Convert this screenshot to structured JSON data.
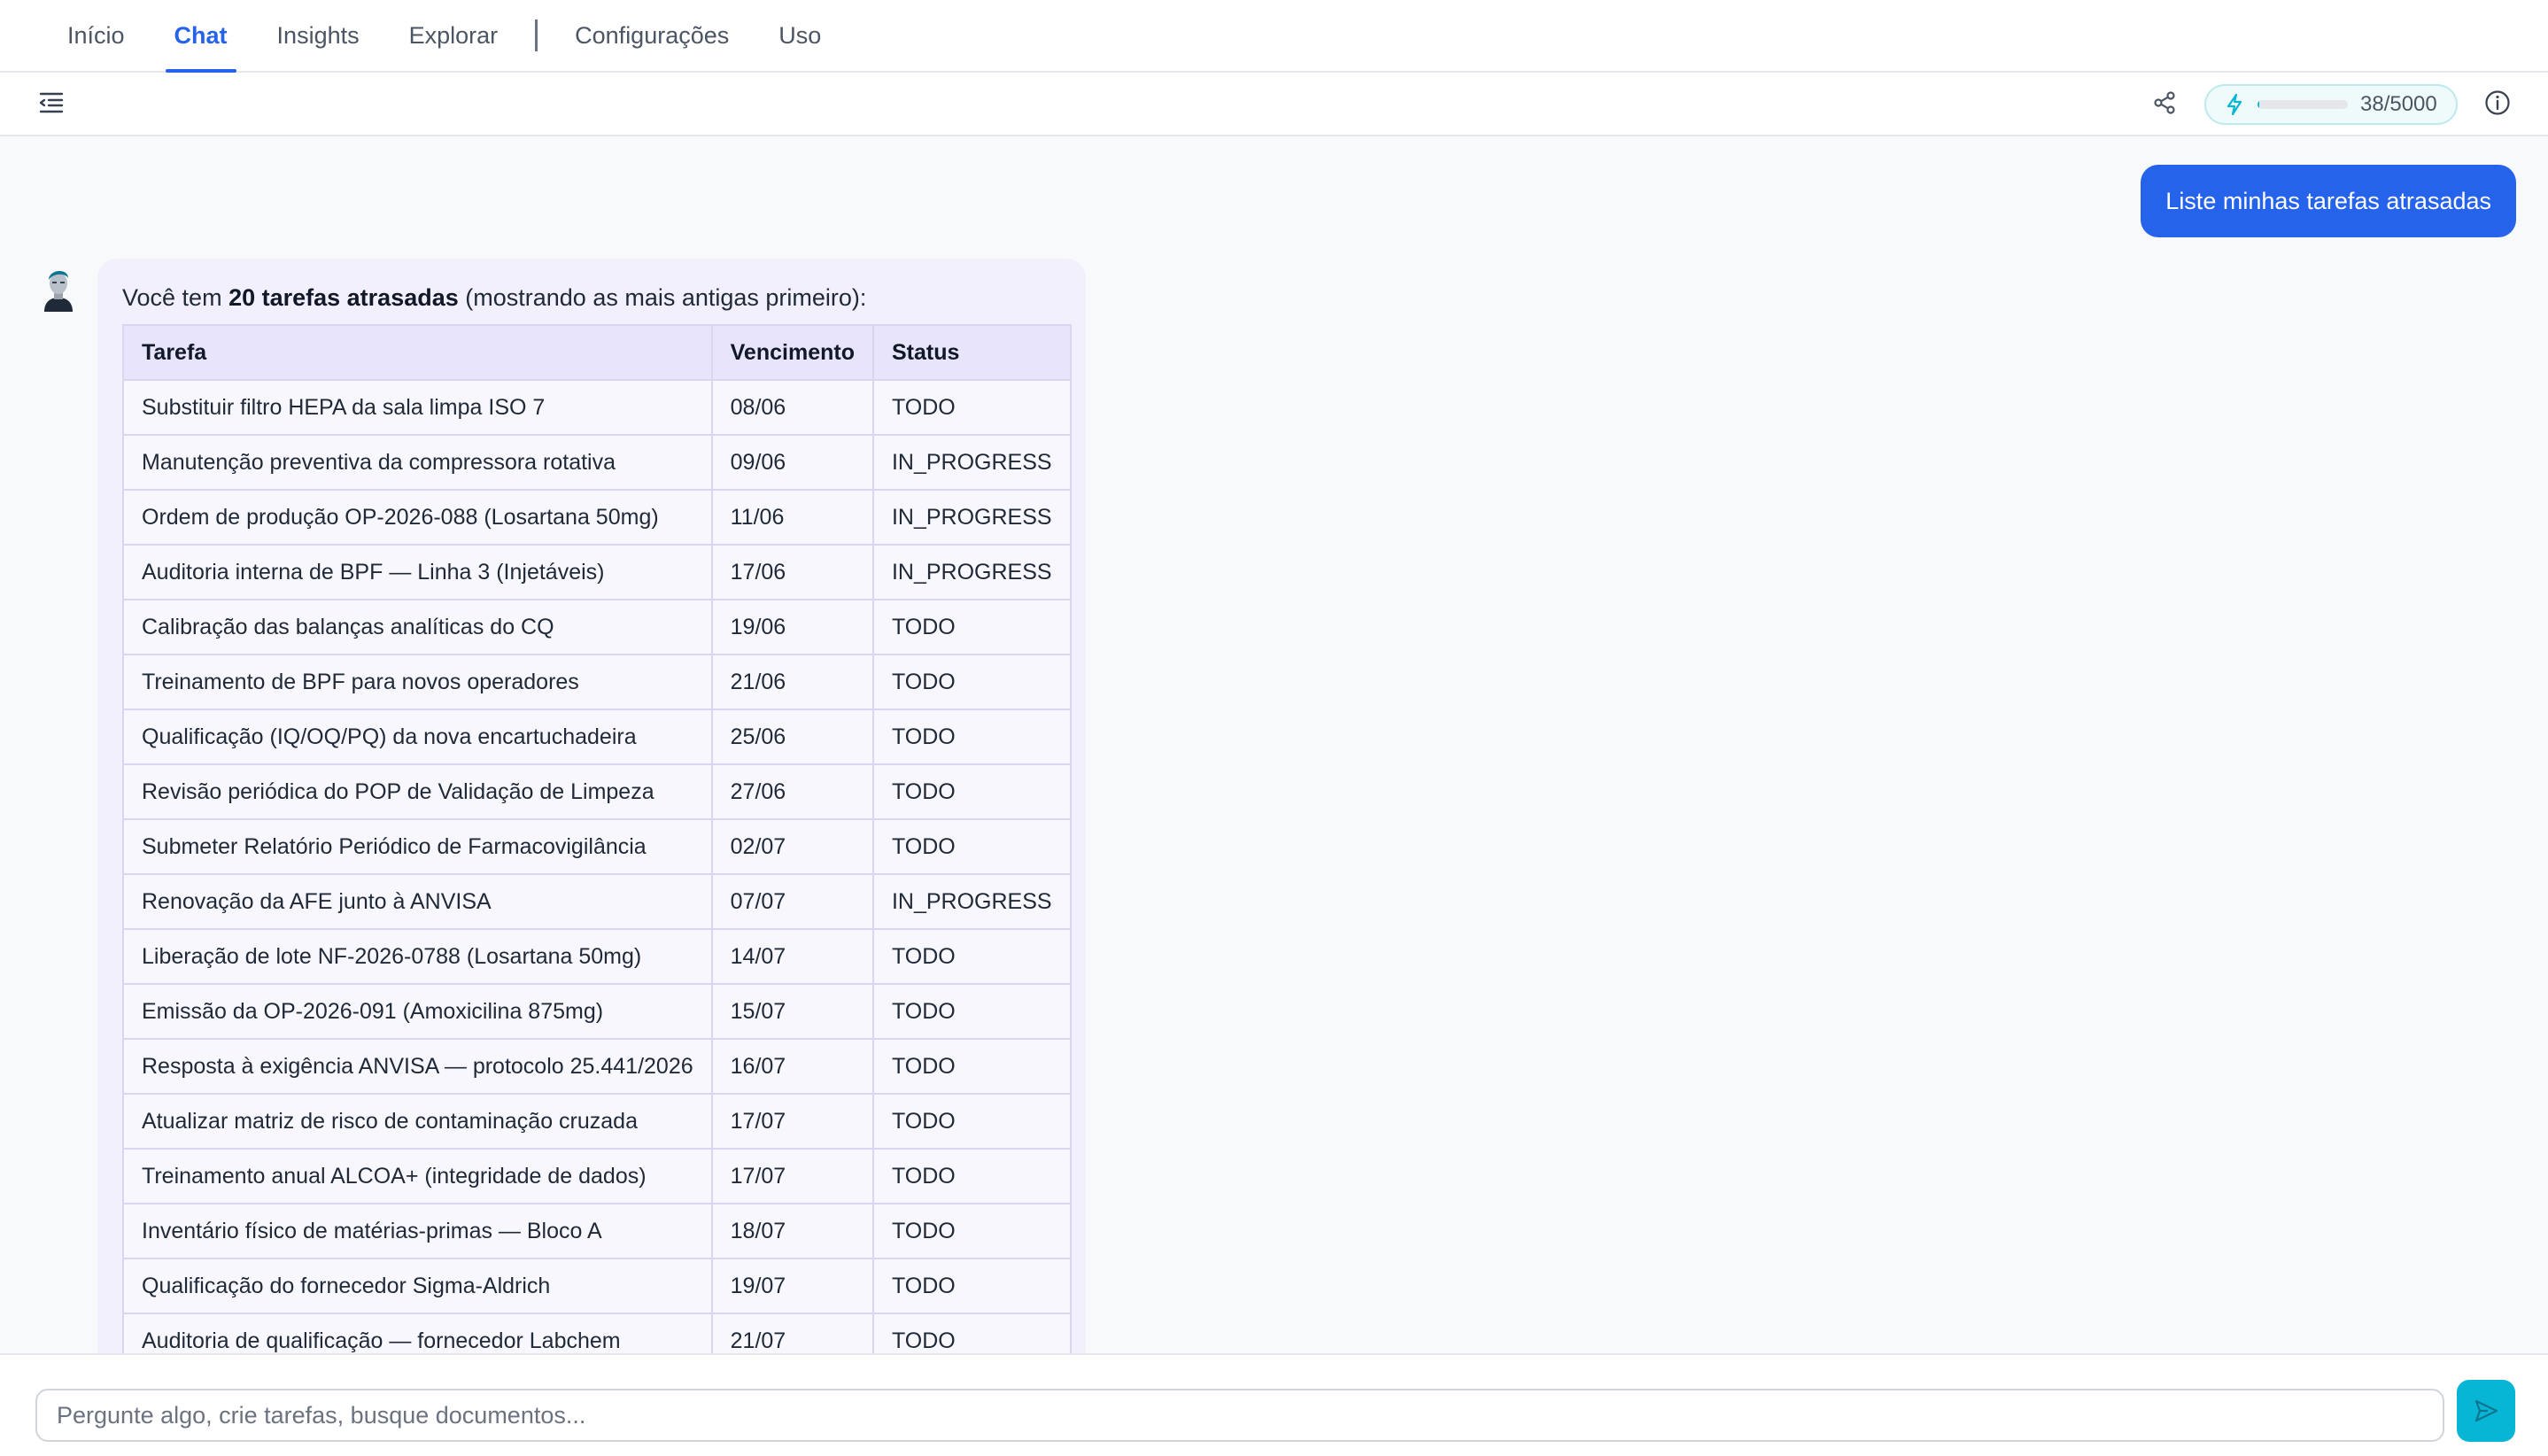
{
  "nav": {
    "tabs": [
      {
        "label": "Início"
      },
      {
        "label": "Chat"
      },
      {
        "label": "Insights"
      },
      {
        "label": "Explorar"
      },
      {
        "label": "Configurações"
      },
      {
        "label": "Uso"
      }
    ],
    "active_tab": "Chat"
  },
  "toolbar": {
    "icons": {
      "collapse": "sidebar-collapse-icon",
      "share": "share-icon",
      "quota": "lightning-icon",
      "info": "info-icon"
    },
    "quota": {
      "used": 38,
      "total": 5000,
      "label": "38/5000"
    }
  },
  "chat": {
    "user_message": "Liste minhas tarefas atrasadas",
    "assistant": {
      "intro_prefix": "Você tem ",
      "intro_bold": "20 tarefas atrasadas",
      "intro_suffix": " (mostrando as mais antigas primeiro):",
      "table": {
        "headers": [
          "Tarefa",
          "Vencimento",
          "Status"
        ],
        "rows": [
          [
            "Substituir filtro HEPA da sala limpa ISO 7",
            "08/06",
            "TODO"
          ],
          [
            "Manutenção preventiva da compressora rotativa",
            "09/06",
            "IN_PROGRESS"
          ],
          [
            "Ordem de produção OP-2026-088 (Losartana 50mg)",
            "11/06",
            "IN_PROGRESS"
          ],
          [
            "Auditoria interna de BPF — Linha 3 (Injetáveis)",
            "17/06",
            "IN_PROGRESS"
          ],
          [
            "Calibração das balanças analíticas do CQ",
            "19/06",
            "TODO"
          ],
          [
            "Treinamento de BPF para novos operadores",
            "21/06",
            "TODO"
          ],
          [
            "Qualificação (IQ/OQ/PQ) da nova encartuchadeira",
            "25/06",
            "TODO"
          ],
          [
            "Revisão periódica do POP de Validação de Limpeza",
            "27/06",
            "TODO"
          ],
          [
            "Submeter Relatório Periódico de Farmacovigilância",
            "02/07",
            "TODO"
          ],
          [
            "Renovação da AFE junto à ANVISA",
            "07/07",
            "IN_PROGRESS"
          ],
          [
            "Liberação de lote NF-2026-0788 (Losartana 50mg)",
            "14/07",
            "TODO"
          ],
          [
            "Emissão da OP-2026-091 (Amoxicilina 875mg)",
            "15/07",
            "TODO"
          ],
          [
            "Resposta à exigência ANVISA — protocolo 25.441/2026",
            "16/07",
            "TODO"
          ],
          [
            "Atualizar matriz de risco de contaminação cruzada",
            "17/07",
            "TODO"
          ],
          [
            "Treinamento anual ALCOA+ (integridade de dados)",
            "17/07",
            "TODO"
          ],
          [
            "Inventário físico de matérias-primas — Bloco A",
            "18/07",
            "TODO"
          ],
          [
            "Qualificação do fornecedor Sigma-Aldrich",
            "19/07",
            "TODO"
          ],
          [
            "Auditoria de qualificação — fornecedor Labchem",
            "21/07",
            "TODO"
          ]
        ]
      }
    }
  },
  "input": {
    "placeholder": "Pergunte algo, crie tarefas, busque documentos...",
    "value": ""
  },
  "colors": {
    "accent": "#2563eb",
    "send": "#06b6d4",
    "assistant_bg": "#f3f0fd"
  }
}
